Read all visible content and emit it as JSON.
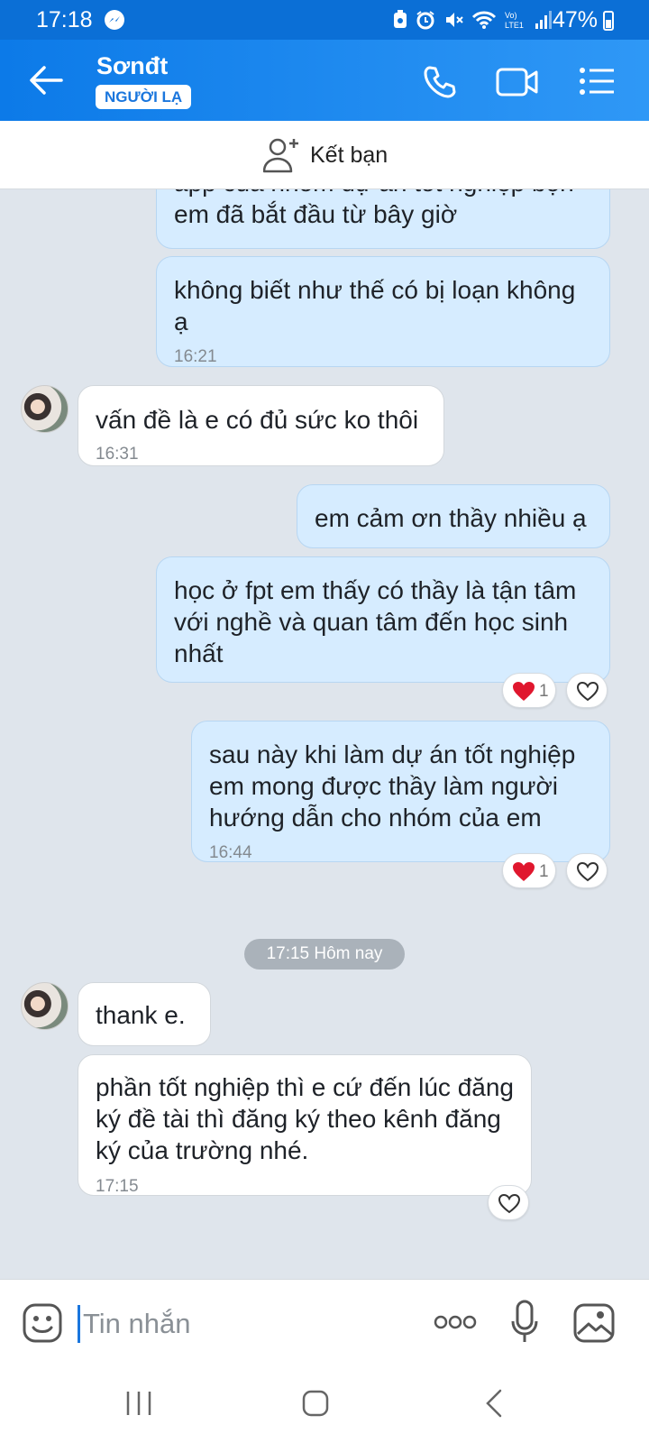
{
  "status_bar": {
    "time": "17:18",
    "battery": "47%",
    "network_label": "Vo)\nLTE1"
  },
  "header": {
    "contact_name": "Sơnđt",
    "badge": "NGƯỜI LẠ"
  },
  "add_friend": {
    "label": "Kết bạn"
  },
  "messages": [
    {
      "dir": "out",
      "text": "app của nhóm dự án tốt nghiệp bọn em đã bắt đầu từ bây giờ",
      "time": ""
    },
    {
      "dir": "out",
      "text": "không biết như thế có bị loạn không ạ",
      "time": "16:21"
    },
    {
      "dir": "in",
      "text": "vấn đề là e có đủ sức ko thôi",
      "time": "16:31"
    },
    {
      "dir": "out",
      "text": "em cảm ơn thầy nhiều ạ",
      "time": ""
    },
    {
      "dir": "out",
      "text": "học ở fpt em thấy có thầy là tận tâm với nghề và quan tâm đến học sinh nhất",
      "time": "",
      "reaction_count": "1"
    },
    {
      "dir": "out",
      "text": "sau này khi làm dự án tốt nghiệp em mong được thầy làm người hướng dẫn cho nhóm của em",
      "time": "16:44",
      "reaction_count": "1"
    },
    {
      "dir": "in",
      "text": "thank e.",
      "time": ""
    },
    {
      "dir": "in",
      "text": "phần tốt nghiệp thì e cứ đến lúc đăng ký đề tài thì đăng ký theo kênh đăng ký của trường nhé.",
      "time": "17:15"
    }
  ],
  "date_separator": "17:15 Hôm nay",
  "input": {
    "placeholder": "Tin nhắn"
  },
  "colors": {
    "header": "#1a85ef",
    "status_bar": "#0b6fd6",
    "outgoing_bubble": "#d6ecff",
    "incoming_bubble": "#ffffff",
    "chat_background": "#dfe5ec",
    "reaction_heart": "#e0172e"
  }
}
